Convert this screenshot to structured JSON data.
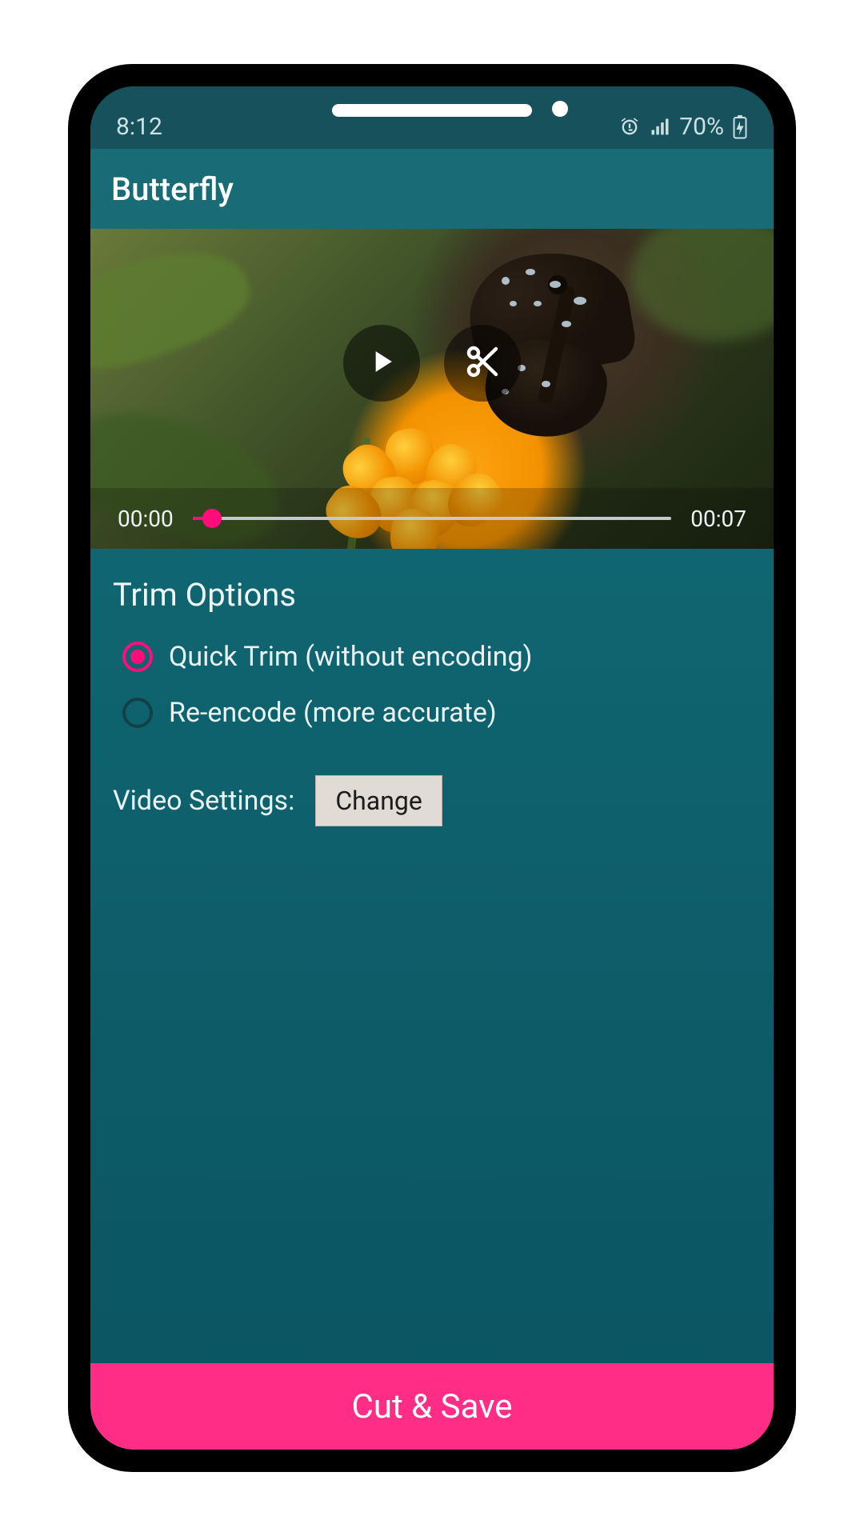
{
  "status_bar": {
    "time": "8:12",
    "battery_text": "70%"
  },
  "app_bar": {
    "title": "Butterfly"
  },
  "video": {
    "start_time": "00:00",
    "end_time": "00:07"
  },
  "trim": {
    "section_title": "Trim Options",
    "options": [
      {
        "label": "Quick Trim (without encoding)",
        "selected": true
      },
      {
        "label": "Re-encode (more accurate)",
        "selected": false
      }
    ]
  },
  "settings": {
    "label": "Video Settings:",
    "button": "Change"
  },
  "primary_action": {
    "label": "Cut & Save"
  },
  "colors": {
    "accent": "#ff0d7b",
    "primary_button": "#ff2d86",
    "teal_dark": "#17515b",
    "teal": "#196b76"
  }
}
